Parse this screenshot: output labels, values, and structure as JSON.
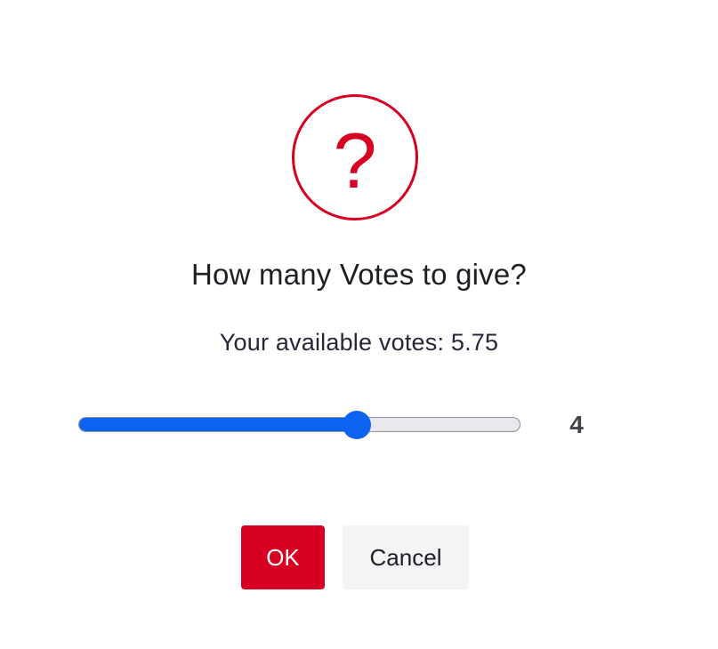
{
  "dialog": {
    "icon": "question-icon",
    "icon_glyph": "?",
    "title": "How many Votes to give?",
    "subtitle": "Your available votes: 5.75",
    "slider": {
      "value": 4,
      "value_label": "4",
      "fraction": 0.63
    },
    "ok_label": "OK",
    "cancel_label": "Cancel"
  },
  "colors": {
    "accent": "#d70022",
    "slider_fill": "#0b63f0",
    "track": "#e9e9ed",
    "cancel_bg": "#f4f4f5"
  }
}
